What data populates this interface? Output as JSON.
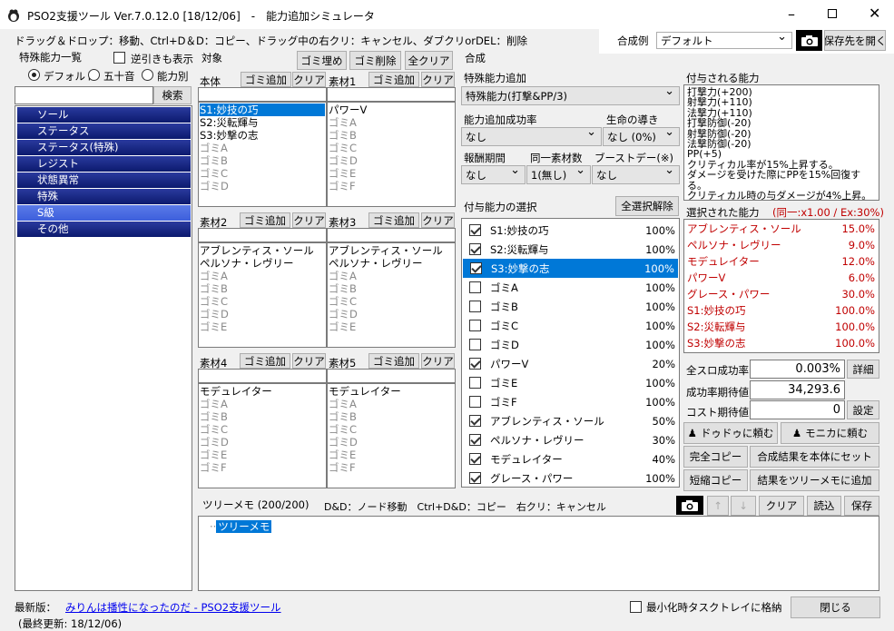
{
  "window": {
    "title": "PSO2支援ツール Ver.7.0.12.0 [18/12/06]　-　能力追加シミュレータ"
  },
  "help_text": "ドラッグ＆ドロップ：移動、Ctrl+D＆D：コピー、ドラッグ中の右クリ：キャンセル、ダブクリorDEL：削除",
  "recipe": {
    "label": "合成例",
    "value": "デフォルト",
    "open_label": "保存先を開く"
  },
  "left": {
    "title": "特殊能力一覧",
    "reverse_label": "逆引きも表示",
    "radios": [
      "デフォルト",
      "五十音",
      "能力別"
    ],
    "search_label": "検索",
    "categories": [
      "ソール",
      "ステータス",
      "ステータス(特殊)",
      "レジスト",
      "状態異常",
      "特殊",
      "S級",
      "その他"
    ]
  },
  "target": {
    "title": "対象",
    "fill_label": "ゴミ埋め",
    "delete_label": "ゴミ削除",
    "clear_all_label": "全クリア",
    "add_label": "ゴミ追加",
    "clear_label": "クリア",
    "slots": [
      {
        "name": "本体",
        "items": [
          "S1:妙技の巧",
          "S2:災転輝与",
          "S3:妙撃の志",
          "ゴミA",
          "ゴミB",
          "ゴミC",
          "ゴミD"
        ],
        "gray_from": 3
      },
      {
        "name": "素材1",
        "items": [
          "パワーV",
          "ゴミA",
          "ゴミB",
          "ゴミC",
          "ゴミD",
          "ゴミE",
          "ゴミF"
        ],
        "gray_from": 1
      },
      {
        "name": "素材2",
        "items": [
          "アブレンティス・ソール",
          "ペルソナ・レヴリー",
          "ゴミA",
          "ゴミB",
          "ゴミC",
          "ゴミD",
          "ゴミE"
        ],
        "gray_from": 2
      },
      {
        "name": "素材3",
        "items": [
          "アブレンティス・ソール",
          "ペルソナ・レヴリー",
          "ゴミA",
          "ゴミB",
          "ゴミC",
          "ゴミD",
          "ゴミE"
        ],
        "gray_from": 2
      },
      {
        "name": "素材4",
        "items": [
          "モデュレイター",
          "ゴミA",
          "ゴミB",
          "ゴミC",
          "ゴミD",
          "ゴミE",
          "ゴミF"
        ],
        "gray_from": 1
      },
      {
        "name": "素材5",
        "items": [
          "モデュレイター",
          "ゴミA",
          "ゴミB",
          "ゴミC",
          "ゴミD",
          "ゴミE",
          "ゴミF"
        ],
        "gray_from": 1
      }
    ]
  },
  "synth": {
    "title": "合成",
    "special_label": "特殊能力追加",
    "special_value": "特殊能力(打撃&PP/3)",
    "rate_label": "能力追加成功率",
    "rate_value": "なし",
    "life_label": "生命の導き",
    "life_value": "なし (0%)",
    "period_label": "報酬期間",
    "period_value": "なし",
    "same_label": "同一素材数",
    "same_value": "1(無し)",
    "boost_label": "ブーストデー(※)",
    "boost_value": "なし",
    "select_label": "付与能力の選択",
    "deselect_label": "全選択解除",
    "abilities": [
      {
        "name": "S1:妙技の巧",
        "pct": "100%",
        "on": true
      },
      {
        "name": "S2:災転輝与",
        "pct": "100%",
        "on": true
      },
      {
        "name": "S3:妙撃の志",
        "pct": "100%",
        "on": true
      },
      {
        "name": "ゴミA",
        "pct": "100%",
        "on": false
      },
      {
        "name": "ゴミB",
        "pct": "100%",
        "on": false
      },
      {
        "name": "ゴミC",
        "pct": "100%",
        "on": false
      },
      {
        "name": "ゴミD",
        "pct": "100%",
        "on": false
      },
      {
        "name": "パワーV",
        "pct": "20%",
        "on": true
      },
      {
        "name": "ゴミE",
        "pct": "100%",
        "on": false
      },
      {
        "name": "ゴミF",
        "pct": "100%",
        "on": false
      },
      {
        "name": "アブレンティス・ソール",
        "pct": "50%",
        "on": true
      },
      {
        "name": "ペルソナ・レヴリー",
        "pct": "30%",
        "on": true
      },
      {
        "name": "モデュレイター",
        "pct": "40%",
        "on": true
      },
      {
        "name": "グレース・パワー",
        "pct": "100%",
        "on": true
      }
    ]
  },
  "granted": {
    "title": "付与される能力",
    "lines": [
      "打撃力(+200)",
      "射撃力(+110)",
      "法撃力(+110)",
      "打撃防御(-20)",
      "射撃防御(-20)",
      "法撃防御(-20)",
      "PP(+5)",
      "クリティカル率が15%上昇する。",
      "ダメージを受けた際にPPを15%回復する。",
      "クリティカル時の与ダメージが4%上昇。"
    ]
  },
  "selected": {
    "title": "選択された能力",
    "note": "(同一:x1.00 / Ex:30%)",
    "items": [
      {
        "name": "アブレンティス・ソール",
        "pct": "15.0%"
      },
      {
        "name": "ペルソナ・レヴリー",
        "pct": "9.0%"
      },
      {
        "name": "モデュレイター",
        "pct": "12.0%"
      },
      {
        "name": "パワーV",
        "pct": "6.0%"
      },
      {
        "name": "グレース・パワー",
        "pct": "30.0%"
      },
      {
        "name": "S1:妙技の巧",
        "pct": "100.0%"
      },
      {
        "name": "S2:災転輝与",
        "pct": "100.0%"
      },
      {
        "name": "S3:妙撃の志",
        "pct": "100.0%"
      }
    ]
  },
  "stats": {
    "all_label": "全スロ成功率",
    "all_value": "0.003%",
    "detail_label": "詳細",
    "expect_label": "成功率期待値",
    "expect_value": "34,293.6",
    "cost_label": "コスト期待値",
    "cost_value": "0",
    "settings_label": "設定"
  },
  "actions": {
    "dododdo": "ドゥドゥに頼む",
    "monica": "モニカに頼む",
    "full_copy": "完全コピー",
    "set_body": "合成結果を本体にセット",
    "short_copy": "短縮コピー",
    "to_tree": "結果をツリーメモに追加"
  },
  "tree": {
    "title": "ツリーメモ (200/200)",
    "hint": "D&D：ノード移動　Ctrl+D&D：コピー　右クリ：キャンセル",
    "clear": "クリア",
    "load": "読込",
    "save": "保存",
    "node": "ツリーメモ"
  },
  "footer": {
    "latest_label": "最新版：",
    "link": "みりんは播性になったのだ - PSO2支援ツール",
    "updated": "(最終更新: 18/12/06)",
    "tray_label": "最小化時タスクトレイに格納",
    "close": "閉じる"
  }
}
